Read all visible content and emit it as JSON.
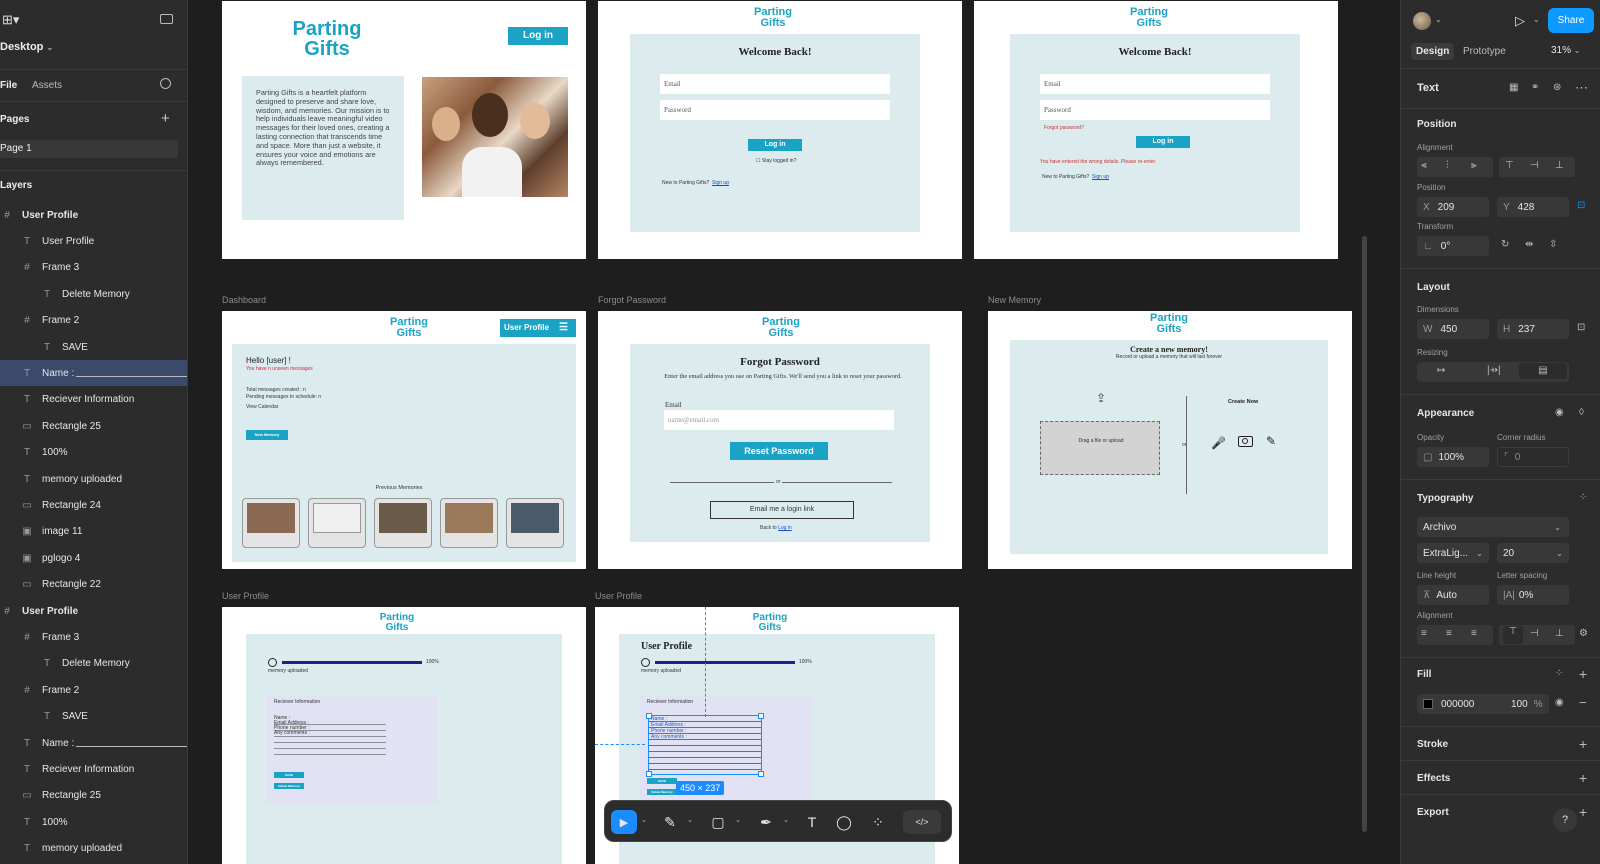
{
  "left": {
    "file_name": "Desktop",
    "tab_file": "File",
    "tab_assets": "Assets",
    "pages_title": "Pages",
    "page1": "Page 1",
    "layers_title": "Layers",
    "layers": [
      {
        "label": "User Profile",
        "icon": "#"
      },
      {
        "label": "User Profile",
        "icon": "T"
      },
      {
        "label": "Frame 3",
        "icon": "#"
      },
      {
        "label": "Delete Memory",
        "icon": "T"
      },
      {
        "label": "Frame 2",
        "icon": "#"
      },
      {
        "label": "SAVE",
        "icon": "T"
      },
      {
        "label": "Name :",
        "icon": "T"
      },
      {
        "label": "Reciever Information",
        "icon": "T"
      },
      {
        "label": "Rectangle 25",
        "icon": "▭"
      },
      {
        "label": "100%",
        "icon": "T"
      },
      {
        "label": "memory uploaded",
        "icon": "T"
      },
      {
        "label": "Rectangle 24",
        "icon": "▭"
      },
      {
        "label": "image 11",
        "icon": "▣"
      },
      {
        "label": "pglogo 4",
        "icon": "▣"
      },
      {
        "label": "Rectangle 22",
        "icon": "▭"
      },
      {
        "label": "User Profile",
        "icon": "#"
      },
      {
        "label": "Frame 3",
        "icon": "#"
      },
      {
        "label": "Delete Memory",
        "icon": "T"
      },
      {
        "label": "Frame 2",
        "icon": "#"
      },
      {
        "label": "SAVE",
        "icon": "T"
      },
      {
        "label": "Name :",
        "icon": "T"
      },
      {
        "label": "Reciever Information",
        "icon": "T"
      },
      {
        "label": "Rectangle 25",
        "icon": "▭"
      },
      {
        "label": "100%",
        "icon": "T"
      },
      {
        "label": "memory uploaded",
        "icon": "T"
      }
    ]
  },
  "canvas": {
    "frame_labels": {
      "dashboard": "Dashboard",
      "forgot": "Forgot Password",
      "new_memory": "New Memory",
      "profile1": "User Profile",
      "profile2": "User Profile"
    },
    "logo_line1": "Parting",
    "logo_line2": "Gifts",
    "home": {
      "login": "Log in",
      "about": "Parting Gifts is a heartfelt platform designed to preserve and share love, wisdom, and memories. Our mission is to help individuals leave meaningful video messages for their loved ones, creating a lasting connection that transcends time and space. More than just a website, it ensures your voice and emotions are always remembered."
    },
    "login1": {
      "title": "Welcome Back!",
      "email": "Email",
      "password": "Password",
      "button": "Log in",
      "keep": "Stay logged in?",
      "new": "New to Parting Gifts?",
      "signup": "Sign up"
    },
    "login2": {
      "title": "Welcome Back!",
      "email": "Email",
      "password": "Password",
      "forgot": "Forgot password?",
      "button": "Log in",
      "error": "You have entered the wrong details. Please re-enter.",
      "new": "New to Parting Gifts?",
      "signup": "Sign up"
    },
    "dashboard": {
      "profile_btn": "User Profile",
      "hello": "Hello [user] !",
      "unseen": "You have n unseen messages",
      "total": "Total messages created : n",
      "pending": "Pending messages to schedule: n",
      "calendar": "View Calendar",
      "new_memory": "New Memory",
      "previous": "Previous Memories"
    },
    "forgot": {
      "title": "Forgot Password",
      "desc": "Enter the email address you use on Parting Gifts. We'll send you a link to reset your password.",
      "email_label": "Email",
      "placeholder": "name@email.com",
      "reset": "Reset Password",
      "or": "or",
      "login_link": "Email me a login link",
      "back": "Back to",
      "back_link": "Log in"
    },
    "newmem": {
      "title": "Create a new memory!",
      "subtitle": "Record or upload a memory that will last forever",
      "drag": "Drag a file or upload",
      "or": "or",
      "create_now": "Create Now"
    },
    "profile": {
      "title": "User Profile",
      "progress_pct": "100%",
      "uploaded": "memory uploaded",
      "recv": "Reciever Information",
      "name": "Name :",
      "email": "Email Address :",
      "phone": "Phone number :",
      "comments": "Any comments :",
      "save": "SAVE",
      "delete": "Delete Memory",
      "dims": "450 × 237",
      "progress_value": 1.0
    }
  },
  "toolbar": {
    "move": "▶",
    "pen": "✎",
    "rect": "▢",
    "pen2": "✒",
    "text": "T",
    "comment": "◯",
    "actions": "⁘",
    "dev": "</>"
  },
  "right": {
    "share": "Share",
    "tab_design": "Design",
    "tab_prototype": "Prototype",
    "zoom": "31%",
    "text_title": "Text",
    "position_title": "Position",
    "alignment_label": "Alignment",
    "position_label": "Position",
    "x_label": "X",
    "x_val": "209",
    "y_label": "Y",
    "y_val": "428",
    "transform_label": "Transform",
    "rotation": "0°",
    "layout_title": "Layout",
    "dimensions_label": "Dimensions",
    "w_label": "W",
    "w_val": "450",
    "h_label": "H",
    "h_val": "237",
    "resizing_label": "Resizing",
    "appearance_title": "Appearance",
    "opacity_label": "Opacity",
    "opacity_val": "100%",
    "radius_label": "Corner radius",
    "radius_val": "0",
    "typography_title": "Typography",
    "font": "Archivo",
    "weight": "ExtraLig...",
    "size": "20",
    "line_height_label": "Line height",
    "line_height_val": "Auto",
    "letter_spacing_label": "Letter spacing",
    "letter_spacing_val": "0%",
    "alignment2_label": "Alignment",
    "fill_title": "Fill",
    "fill_hex": "000000",
    "fill_opacity": "100",
    "fill_pct": "%",
    "stroke_title": "Stroke",
    "effects_title": "Effects",
    "export_title": "Export",
    "help": "?"
  }
}
